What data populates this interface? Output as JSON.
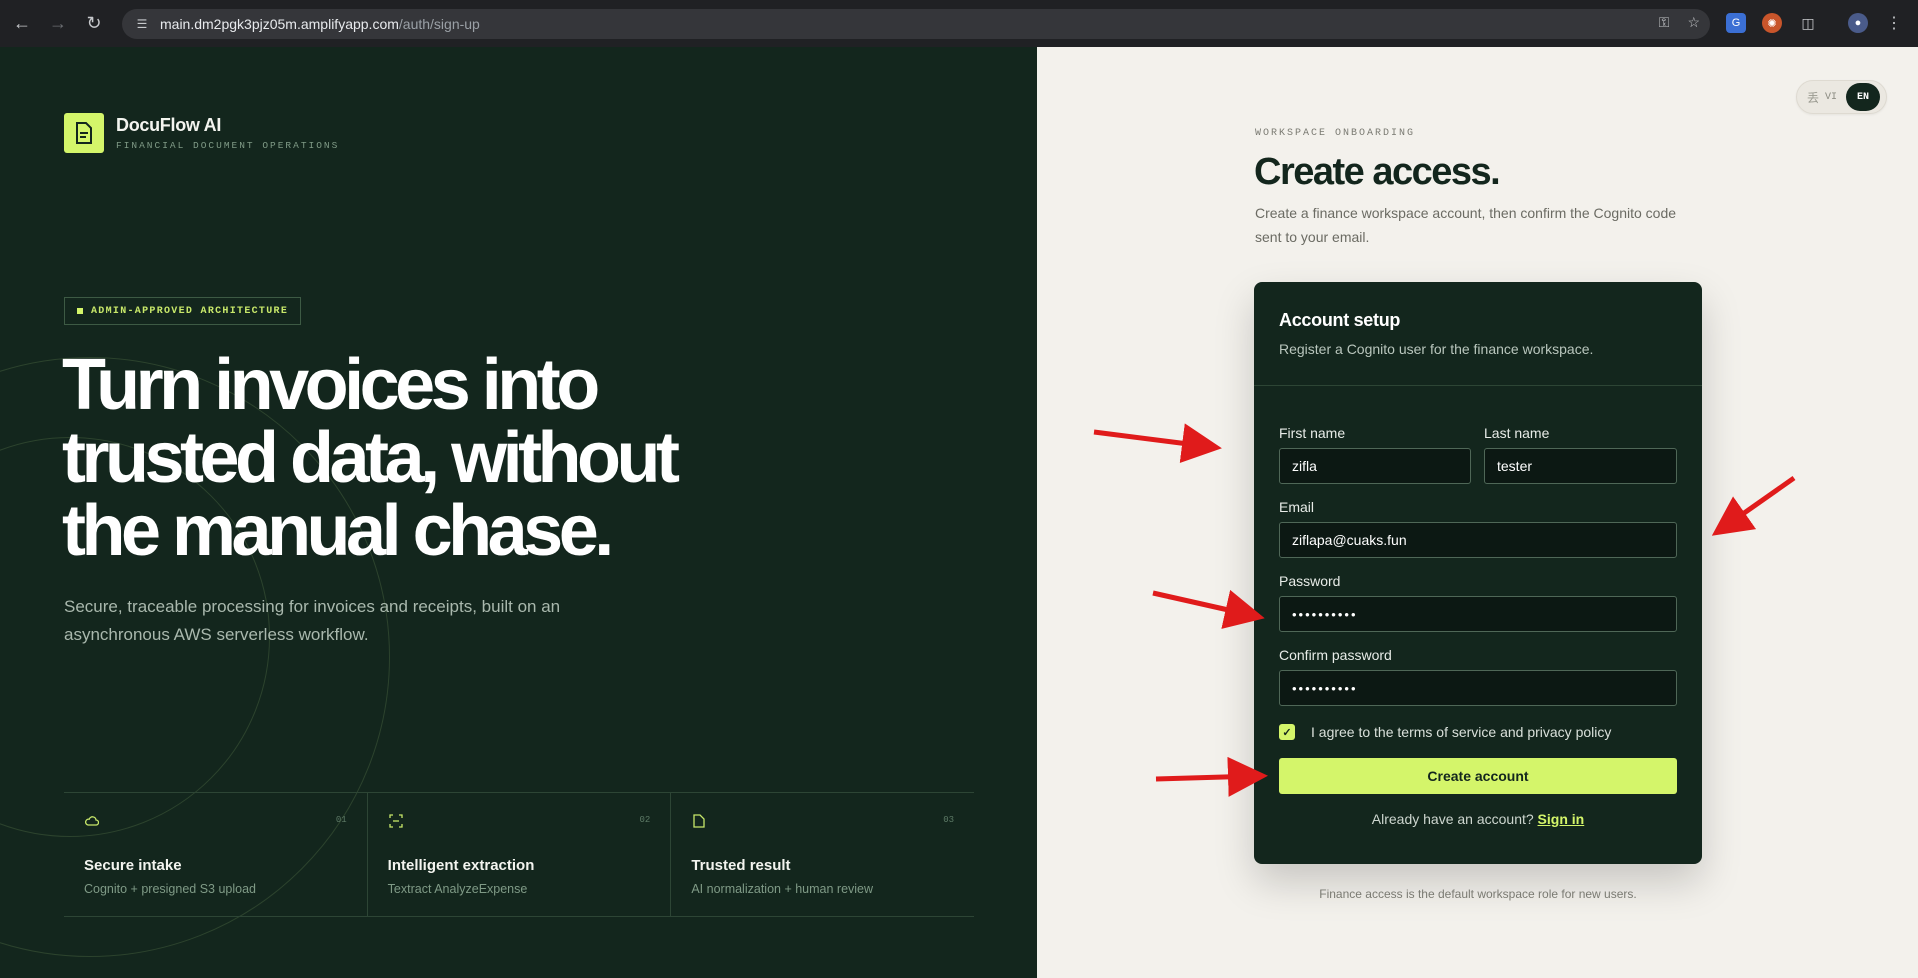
{
  "browser": {
    "url_host": "main.dm2pgk3pjz05m.amplifyapp.com",
    "url_path": "/auth/sign-up"
  },
  "brand": {
    "name": "DocuFlow AI",
    "tagline": "FINANCIAL DOCUMENT OPERATIONS"
  },
  "hero": {
    "badge": "ADMIN-APPROVED ARCHITECTURE",
    "headline": "Turn invoices into trusted data, without the manual chase.",
    "subtext": "Secure, traceable processing for invoices and receipts, built on an asynchronous AWS serverless workflow."
  },
  "features": [
    {
      "num": "01",
      "title": "Secure intake",
      "desc": "Cognito + presigned S3 upload",
      "icon": "cloud-icon"
    },
    {
      "num": "02",
      "title": "Intelligent extraction",
      "desc": "Textract AnalyzeExpense",
      "icon": "scan-icon"
    },
    {
      "num": "03",
      "title": "Trusted result",
      "desc": "AI normalization + human review",
      "icon": "document-icon"
    }
  ],
  "lang": {
    "vi": "VI",
    "en": "EN"
  },
  "page": {
    "eyebrow": "WORKSPACE ONBOARDING",
    "title": "Create access.",
    "subtitle": "Create a finance workspace account, then confirm the Cognito code sent to your email."
  },
  "form": {
    "title": "Account setup",
    "subtitle": "Register a Cognito user for the finance workspace.",
    "first_name_label": "First name",
    "first_name_value": "zifla",
    "last_name_label": "Last name",
    "last_name_value": "tester",
    "email_label": "Email",
    "email_value": "ziflapa@cuaks.fun",
    "password_label": "Password",
    "password_value": "••••••••••",
    "confirm_label": "Confirm password",
    "confirm_value": "••••••••••",
    "terms_label": "I agree to the terms of service and privacy policy",
    "terms_checked": true,
    "submit_label": "Create account",
    "signin_prompt": "Already have an account?",
    "signin_link": "Sign in"
  },
  "footer_note": "Finance access is the default workspace role for new users.",
  "colors": {
    "dark": "#13261d",
    "accent": "#d4f56a",
    "annotation": "#e01b1b"
  }
}
